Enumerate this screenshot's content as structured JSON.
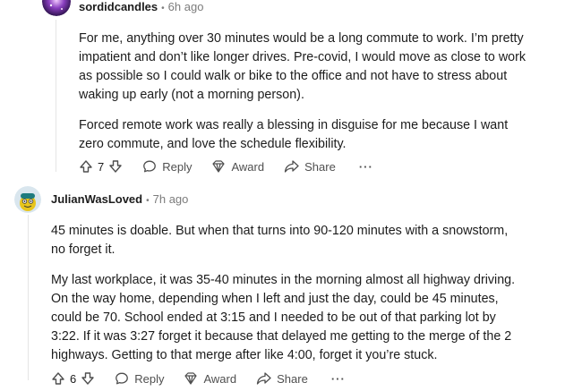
{
  "comments": [
    {
      "username": "sordidcandles",
      "age": "6h ago",
      "paragraphs": [
        "For me, anything over 30 minutes would be a long commute to work. I’m pretty impatient and don’t like longer drives. Pre-covid, I would move as close to work as possible so I could walk or bike to the office and not have to stress about waking up early (not a morning person).",
        "Forced remote work was really a blessing in disguise for me because I want zero commute, and love the schedule flexibility."
      ],
      "score": "7",
      "reply_label": "Reply",
      "award_label": "Award",
      "share_label": "Share",
      "more_label": "···"
    },
    {
      "username": "JulianWasLoved",
      "age": "7h ago",
      "paragraphs": [
        "45 minutes is doable. But when that turns into 90-120 minutes with a snowstorm, no forget it.",
        "My last workplace, it was 35-40 minutes in the morning almost all highway driving. On the way home, depending when I left and just the day, could be 45 minutes, could be 70. School ended at 3:15 and I needed to be out of that parking lot by 3:22. If it was 3:27 forget it because that delayed me getting to the merge of the 2 highways. Getting to that merge after like 4:00, forget it you’re stuck."
      ],
      "score": "6",
      "reply_label": "Reply",
      "award_label": "Award",
      "share_label": "Share",
      "more_label": "···"
    }
  ],
  "dot_separator": "•",
  "colors": {
    "text": "#1c1c1c",
    "meta": "#7c7c7c",
    "actions": "#4f4f4f",
    "thread": "#e5e5e5"
  }
}
